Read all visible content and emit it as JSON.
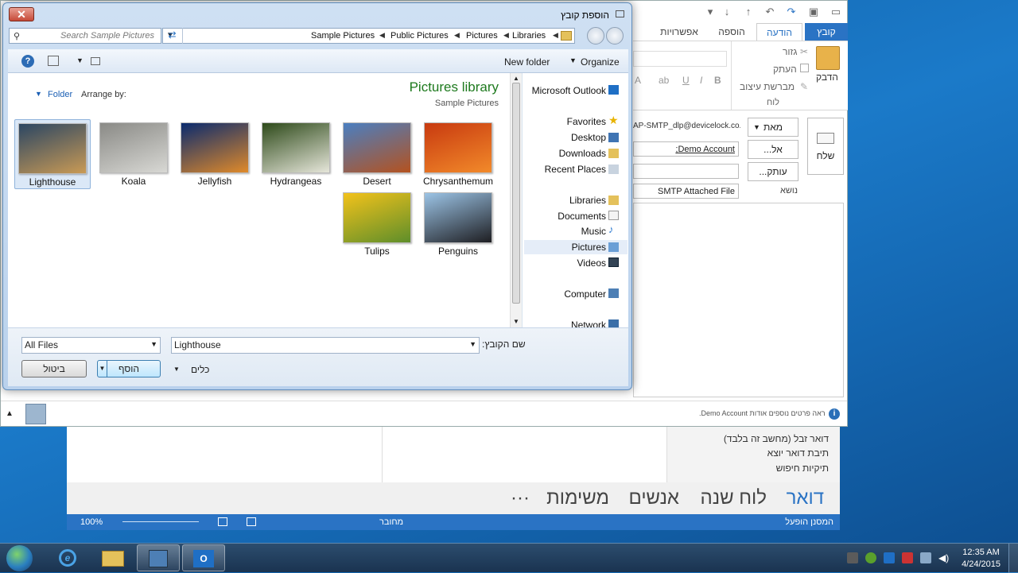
{
  "outlook": {
    "folders": [
      "דואר זבל (מחשב זה בלבד)",
      "תיבת דואר יוצא",
      "תיקיות חיפוש"
    ],
    "nav": {
      "mail": "דואר",
      "calendar": "לוח שנה",
      "people": "אנשים",
      "tasks": "משימות",
      "more": "···"
    },
    "status": {
      "zoom": "100%",
      "connection": "מחובר",
      "screen_reader": "המסנן הופעל"
    }
  },
  "compose": {
    "tabs": {
      "file": "קובץ",
      "message": "הודעה",
      "insert": "הוספה",
      "options": "אפשרויות"
    },
    "ribbon": {
      "paste": "הדבק",
      "cut": "גזור",
      "copy": "העתק",
      "format_painter": "מברשת עיצוב",
      "clipboard_group": "לוח"
    },
    "fields": {
      "send": "שלח",
      "from_btn": "מאת",
      "from_value": "AP-SMTP_dlp@devicelock.co.il",
      "to_btn": "אל...",
      "to_value": "Demo Account;",
      "cc_btn": "עותק...",
      "subject_label": "נושא",
      "subject_value": "SMTP Attached File"
    },
    "people_info": "ראה פרטים נוספים אודות Demo Account."
  },
  "dialog": {
    "title": "הוספת קובץ",
    "search_placeholder": "Search Sample Pictures",
    "breadcrumb": [
      "Libraries",
      "Pictures",
      "Public Pictures",
      "Sample Pictures"
    ],
    "toolbar": {
      "organize": "Organize",
      "new_folder": "New folder"
    },
    "library_title": "Pictures library",
    "library_sub": "Sample Pictures",
    "arrange_by": "Arrange by:",
    "arrange_value": "Folder",
    "thumbnails": [
      {
        "name": "Lighthouse",
        "colors": [
          "#2b4663",
          "#c99a55"
        ]
      },
      {
        "name": "Koala",
        "colors": [
          "#8a8a86",
          "#d8d8d4"
        ]
      },
      {
        "name": "Jellyfish",
        "colors": [
          "#0a2a6e",
          "#e08a2a"
        ]
      },
      {
        "name": "Hydrangeas",
        "colors": [
          "#2e4a1a",
          "#e6e6da"
        ]
      },
      {
        "name": "Desert",
        "colors": [
          "#4a7fc1",
          "#b4521f"
        ]
      },
      {
        "name": "Chrysanthemum",
        "colors": [
          "#c83a10",
          "#f28a2a"
        ]
      },
      {
        "name": "Tulips",
        "colors": [
          "#f3c21b",
          "#5e8e2a"
        ]
      },
      {
        "name": "Penguins",
        "colors": [
          "#9cc4e6",
          "#1e1e22"
        ]
      }
    ],
    "nav_pane": {
      "outlook": "Microsoft Outlook",
      "favorites": "Favorites",
      "desktop": "Desktop",
      "downloads": "Downloads",
      "recent": "Recent Places",
      "libraries": "Libraries",
      "documents": "Documents",
      "music": "Music",
      "pictures": "Pictures",
      "videos": "Videos",
      "computer": "Computer",
      "network": "Network"
    },
    "filename_label": "שם הקובץ:",
    "filename_value": "Lighthouse",
    "filetype_value": "All Files",
    "tools_label": "כלים",
    "insert_btn": "הוסף",
    "cancel_btn": "ביטול"
  },
  "taskbar": {
    "clock_time": "12:35 AM",
    "clock_date": "4/24/2015"
  }
}
